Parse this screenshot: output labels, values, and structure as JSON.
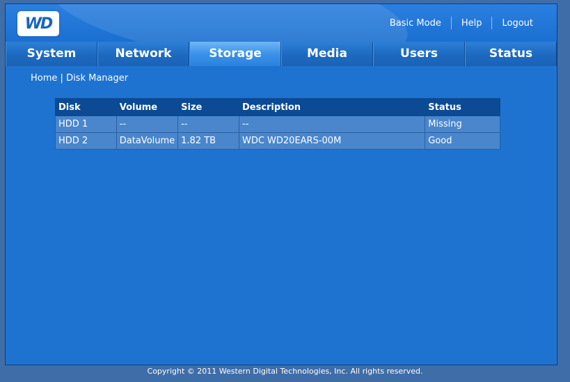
{
  "header": {
    "logo_text": "WD",
    "links": [
      "Basic Mode",
      "Help",
      "Logout"
    ]
  },
  "tabs": [
    {
      "label": "System",
      "active": false
    },
    {
      "label": "Network",
      "active": false
    },
    {
      "label": "Storage",
      "active": true
    },
    {
      "label": "Media",
      "active": false
    },
    {
      "label": "Users",
      "active": false
    },
    {
      "label": "Status",
      "active": false
    }
  ],
  "breadcrumb": {
    "home": "Home",
    "separator": "|",
    "current": "Disk Manager"
  },
  "disk_table": {
    "columns": [
      "Disk",
      "Volume",
      "Size",
      "Description",
      "Status"
    ],
    "rows": [
      [
        "HDD 1",
        "--",
        "--",
        "--",
        "Missing"
      ],
      [
        "HDD 2",
        "DataVolume",
        "1.82 TB",
        "WDC WD20EARS-00M",
        "Good"
      ]
    ]
  },
  "footer": {
    "copyright": "Copyright © 2011 Western Digital Technologies, Inc. All rights reserved."
  },
  "colors": {
    "background": "#1e73d1",
    "page_outer": "#3f6da8",
    "table_header": "#0c4a94",
    "table_row": "#4a86cc"
  }
}
